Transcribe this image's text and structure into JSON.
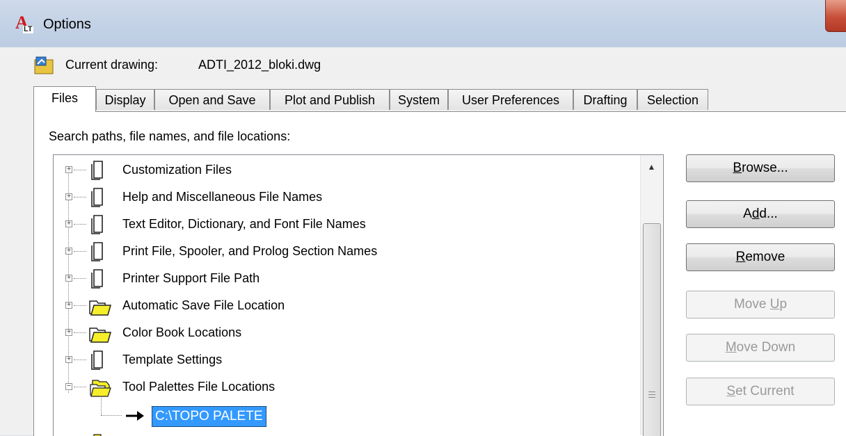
{
  "window": {
    "title": "Options"
  },
  "current_drawing": {
    "label": "Current drawing:",
    "value": "ADTI_2012_bloki.dwg"
  },
  "tabs": [
    {
      "label": "Files"
    },
    {
      "label": "Display"
    },
    {
      "label": "Open and Save"
    },
    {
      "label": "Plot and Publish"
    },
    {
      "label": "System"
    },
    {
      "label": "User Preferences"
    },
    {
      "label": "Drafting"
    },
    {
      "label": "Selection"
    }
  ],
  "files_panel": {
    "search_label": "Search paths, file names, and file locations:",
    "tree": [
      {
        "label": "Customization Files",
        "icon": "page-icon",
        "expanded": false
      },
      {
        "label": "Help and Miscellaneous File Names",
        "icon": "page-icon",
        "expanded": false
      },
      {
        "label": "Text Editor, Dictionary, and Font File Names",
        "icon": "page-icon",
        "expanded": false
      },
      {
        "label": "Print File, Spooler, and Prolog Section Names",
        "icon": "page-icon",
        "expanded": false
      },
      {
        "label": "Printer Support File Path",
        "icon": "page-icon",
        "expanded": false
      },
      {
        "label": "Automatic Save File Location",
        "icon": "folder-icon",
        "expanded": false
      },
      {
        "label": "Color Book Locations",
        "icon": "folder-icon",
        "expanded": false
      },
      {
        "label": "Template Settings",
        "icon": "page-icon",
        "expanded": false
      },
      {
        "label": "Tool Palettes File Locations",
        "icon": "folder-stack-icon",
        "expanded": true
      }
    ],
    "selected_child": "C:\\TOPO PALETE"
  },
  "buttons": {
    "browse": {
      "pre": "",
      "mnemonic": "B",
      "post": "rowse..."
    },
    "add": {
      "pre": "A",
      "mnemonic": "d",
      "post": "d..."
    },
    "remove": {
      "pre": "",
      "mnemonic": "R",
      "post": "emove"
    },
    "move_up": {
      "pre": "Move ",
      "mnemonic": "U",
      "post": "p"
    },
    "move_down": {
      "pre": "",
      "mnemonic": "M",
      "post": "ove Down"
    },
    "set_current": {
      "pre": "",
      "mnemonic": "S",
      "post": "et Current"
    }
  }
}
